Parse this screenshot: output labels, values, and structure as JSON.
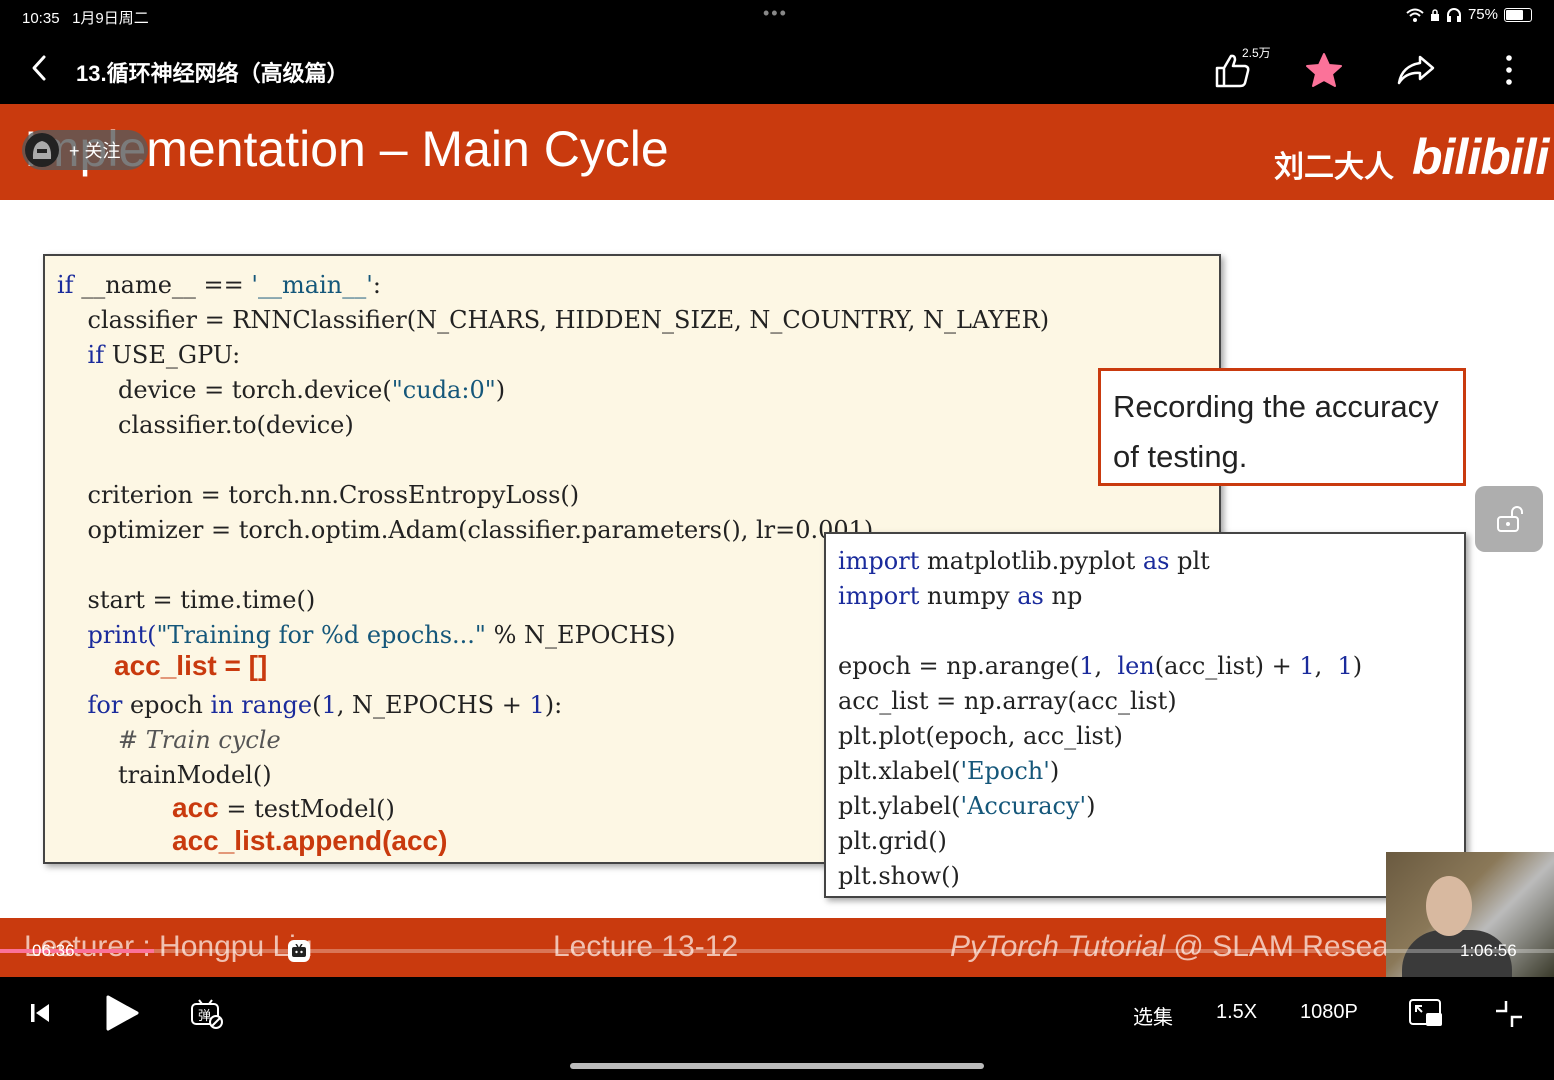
{
  "status_bar": {
    "time": "10:35",
    "date": "1月9日周二",
    "battery": "75%",
    "battery_level": 0.75
  },
  "nav": {
    "title": "13.循环神经网络（高级篇）",
    "like_count": "2.5万"
  },
  "slide": {
    "title": "Implementation – Main Cycle",
    "author": "刘二大人",
    "brand": "bilibili",
    "follow_label": "+ 关注",
    "callout_line1": "Recording the accuracy",
    "callout_line2": "of testing.",
    "code_left": {
      "l1a": "if",
      "l1b": " __name__ == ",
      "l1c": "'__main__'",
      "l1d": ":",
      "l2": "    classifier = RNNClassifier(N_CHARS, HIDDEN_SIZE, N_COUNTRY, N_LAYER)",
      "l3a": "    if",
      "l3b": " USE_GPU:",
      "l4a": "        device = torch.device(",
      "l4b": "\"cuda:0\"",
      "l4c": ")",
      "l5": "        classifier.to(device)",
      "l6": "    criterion = torch.nn.CrossEntropyLoss()",
      "l7": "    optimizer = torch.optim.Adam(classifier.parameters(), lr=0.001)",
      "l8": "    start = time.time()",
      "l9a": "    print(",
      "l9b": "\"Training for %d epochs...\"",
      "l9c": " % N_EPOCHS)",
      "l10": "acc_list = []",
      "l11a": "    for",
      "l11b": " epoch ",
      "l11c": "in",
      "l11d": " ",
      "l11e": "range",
      "l11f": "(",
      "l11g": "1",
      "l11h": ", N_EPOCHS + ",
      "l11i": "1",
      "l11j": "):",
      "l12": "        # Train cycle",
      "l13": "        trainModel()",
      "l14a": "acc",
      "l14b": " = testModel()",
      "l15": "acc_list.append(acc)"
    },
    "code_right": {
      "r1a": "import",
      "r1b": " matplotlib.pyplot ",
      "r1c": "as",
      "r1d": " plt",
      "r2a": "import",
      "r2b": " numpy ",
      "r2c": "as",
      "r2d": " np",
      "r3a": "epoch = np.arange(",
      "r3b": "1",
      "r3c": ",  ",
      "r3d": "len",
      "r3e": "(acc_list) + ",
      "r3f": "1",
      "r3g": ",  ",
      "r3h": "1",
      "r3i": ")",
      "r4": "acc_list = np.array(acc_list)",
      "r5": "plt.plot(epoch, acc_list)",
      "r6a": "plt.xlabel(",
      "r6b": "'Epoch'",
      "r6c": ")",
      "r7a": "plt.ylabel(",
      "r7b": "'Accuracy'",
      "r7c": ")",
      "r8": "plt.grid()",
      "r9": "plt.show()"
    },
    "footer": {
      "lecturer": "Lecturer : Hongpu Liu",
      "lecture": "Lecture 13-12",
      "course_italic": "PyTorch Tutorial",
      "course_rest": " @ SLAM Resea"
    }
  },
  "player": {
    "current_time": "06:36",
    "total_time": "1:06:56",
    "progress": 0.099,
    "episodes_label": "选集",
    "speed_label": "1.5X",
    "quality_label": "1080P"
  }
}
